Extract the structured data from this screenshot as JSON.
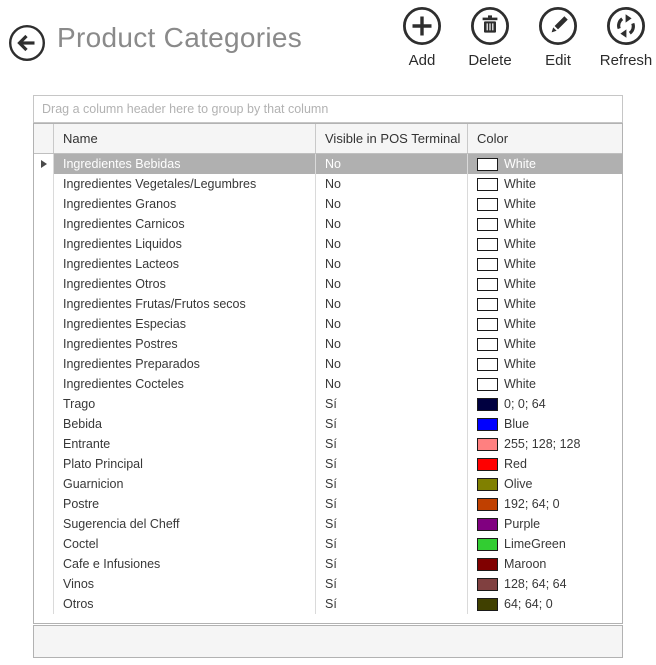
{
  "header": {
    "title": "Product Categories",
    "back_icon": "arrow-left-circle"
  },
  "toolbar": {
    "items": [
      {
        "label": "Add",
        "icon": "add-circle-icon"
      },
      {
        "label": "Delete",
        "icon": "trash-circle-icon"
      },
      {
        "label": "Edit",
        "icon": "pencil-circle-icon"
      },
      {
        "label": "Refresh",
        "icon": "refresh-circle-icon"
      }
    ]
  },
  "group_bar": {
    "text": "Drag a column header here to group by that column"
  },
  "grid": {
    "columns": [
      "Name",
      "Visible in POS Terminal",
      "Color"
    ],
    "selected_row_index": 0,
    "rows": [
      {
        "name": "Ingredientes Bebidas",
        "visible": "No",
        "color_label": "White",
        "color_hex": "#FFFFFF"
      },
      {
        "name": "Ingredientes Vegetales/Legumbres",
        "visible": "No",
        "color_label": "White",
        "color_hex": "#FFFFFF"
      },
      {
        "name": "Ingredientes Granos",
        "visible": "No",
        "color_label": "White",
        "color_hex": "#FFFFFF"
      },
      {
        "name": "Ingredientes Carnicos",
        "visible": "No",
        "color_label": "White",
        "color_hex": "#FFFFFF"
      },
      {
        "name": "Ingredientes Liquidos",
        "visible": "No",
        "color_label": "White",
        "color_hex": "#FFFFFF"
      },
      {
        "name": "Ingredientes Lacteos",
        "visible": "No",
        "color_label": "White",
        "color_hex": "#FFFFFF"
      },
      {
        "name": "Ingredientes Otros",
        "visible": "No",
        "color_label": "White",
        "color_hex": "#FFFFFF"
      },
      {
        "name": "Ingredientes Frutas/Frutos secos",
        "visible": "No",
        "color_label": "White",
        "color_hex": "#FFFFFF"
      },
      {
        "name": "Ingredientes Especias",
        "visible": "No",
        "color_label": "White",
        "color_hex": "#FFFFFF"
      },
      {
        "name": "Ingredientes Postres",
        "visible": "No",
        "color_label": "White",
        "color_hex": "#FFFFFF"
      },
      {
        "name": "Ingredientes Preparados",
        "visible": "No",
        "color_label": "White",
        "color_hex": "#FFFFFF"
      },
      {
        "name": "Ingredientes Cocteles",
        "visible": "No",
        "color_label": "White",
        "color_hex": "#FFFFFF"
      },
      {
        "name": "Trago",
        "visible": "Sí",
        "color_label": "0; 0; 64",
        "color_hex": "#000040"
      },
      {
        "name": "Bebida",
        "visible": "Sí",
        "color_label": "Blue",
        "color_hex": "#0000FF"
      },
      {
        "name": "Entrante",
        "visible": "Sí",
        "color_label": "255; 128; 128",
        "color_hex": "#FF8080"
      },
      {
        "name": "Plato Principal",
        "visible": "Sí",
        "color_label": "Red",
        "color_hex": "#FF0000"
      },
      {
        "name": "Guarnicion",
        "visible": "Sí",
        "color_label": "Olive",
        "color_hex": "#808000"
      },
      {
        "name": "Postre",
        "visible": "Sí",
        "color_label": "192; 64; 0",
        "color_hex": "#C04000"
      },
      {
        "name": "Sugerencia del Cheff",
        "visible": "Sí",
        "color_label": "Purple",
        "color_hex": "#800080"
      },
      {
        "name": "Coctel",
        "visible": "Sí",
        "color_label": "LimeGreen",
        "color_hex": "#32CD32"
      },
      {
        "name": "Cafe e Infusiones",
        "visible": "Sí",
        "color_label": "Maroon",
        "color_hex": "#800000"
      },
      {
        "name": "Vinos",
        "visible": "Sí",
        "color_label": "128; 64; 64",
        "color_hex": "#804040"
      },
      {
        "name": "Otros",
        "visible": "Sí",
        "color_label": "64; 64; 0",
        "color_hex": "#404000"
      }
    ]
  },
  "theme": {
    "selected_row_bg": "#B0B0B0",
    "selected_row_text": "#FFFFFF",
    "header_row_bg": "#F5F5F5",
    "icon_color": "#2E2E2E",
    "title_color": "#8A8A8A"
  }
}
